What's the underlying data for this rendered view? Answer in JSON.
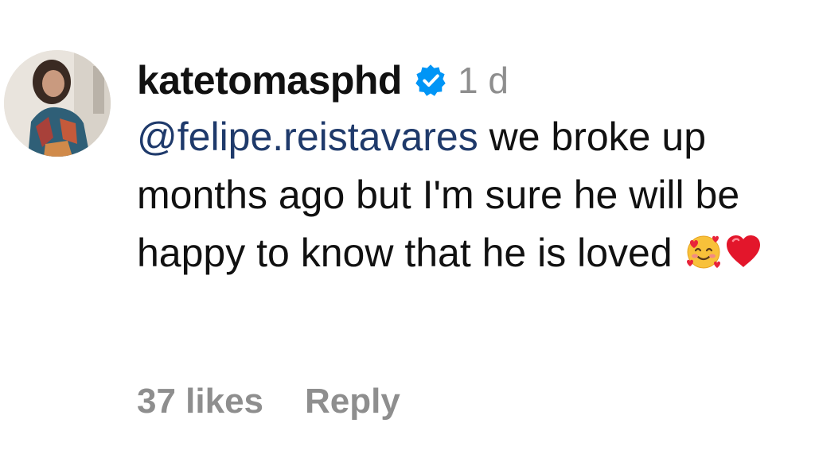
{
  "comment": {
    "username": "katetomasphd",
    "verified_icon": "verified-badge-icon",
    "time": "1 d",
    "mention": "@felipe.reistavares",
    "text": " we broke up months ago but I'm sure he will be happy to know that he is loved ",
    "emojis": [
      "smiling-face-with-hearts-icon",
      "red-heart-icon"
    ],
    "likes": "37 likes",
    "reply_label": "Reply"
  },
  "colors": {
    "verified_blue": "#0095f6",
    "mention": "#1f3a6b",
    "muted": "#8e8e8e",
    "text": "#111111"
  }
}
